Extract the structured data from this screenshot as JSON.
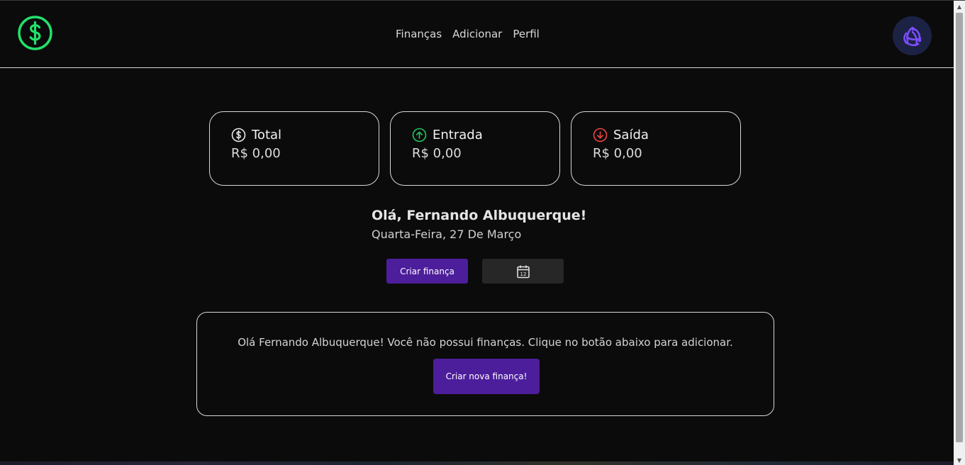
{
  "nav": {
    "items": [
      {
        "label": "Finanças"
      },
      {
        "label": "Adicionar"
      },
      {
        "label": "Perfil"
      }
    ]
  },
  "cards": [
    {
      "title": "Total",
      "value": "R$ 0,00",
      "icon": "dollar-circle-icon",
      "icon_color": "#e8e8e8"
    },
    {
      "title": "Entrada",
      "value": "R$ 0,00",
      "icon": "arrow-up-circle-icon",
      "icon_color": "#22c55e"
    },
    {
      "title": "Saída",
      "value": "R$ 0,00",
      "icon": "arrow-down-circle-icon",
      "icon_color": "#ef4444"
    }
  ],
  "greeting": {
    "name": "Olá, Fernando Albuquerque!",
    "date": "Quarta-Feira, 27 De Março"
  },
  "actions": {
    "create_label": "Criar finança",
    "calendar_day": "12"
  },
  "empty_state": {
    "message": "Olá Fernando Albuquerque! Você não possui finanças. Clique no botão abaixo para adicionar.",
    "button_label": "Criar nova finança!"
  },
  "colors": {
    "accent": "#4d1e9b",
    "logo": "#22e06a",
    "background": "#0b0b0b"
  }
}
